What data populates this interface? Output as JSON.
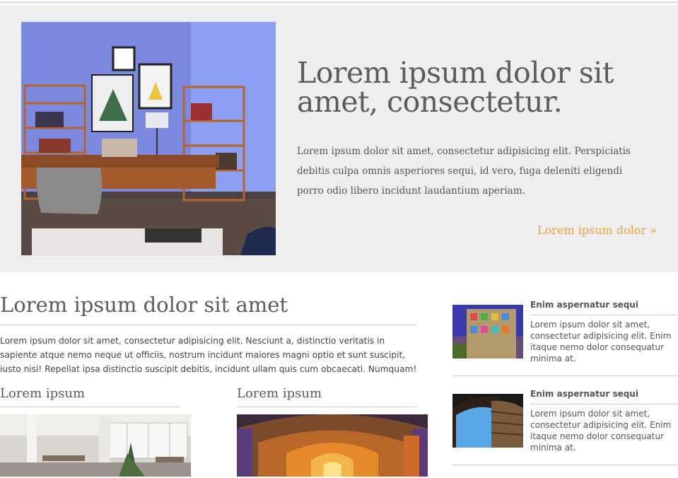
{
  "hero": {
    "title": "Lorem ipsum dolor sit amet, consectetur.",
    "text": "Lorem ipsum dolor sit amet, consectetur adipisicing elit. Perspiciatis debitis culpa omnis asperiores sequi, id vero, fuga deleniti eligendi porro odio libero incidunt laudantium aperiam.",
    "link": "Lorem ipsum dolor »",
    "link_color": "#e8a33d"
  },
  "main": {
    "title": "Lorem ipsum dolor sit amet",
    "text": "Lorem ipsum dolor sit amet, consectetur adipisicing elit. Nesciunt a, distinctio veritatis in sapiente atque nemo neque ut officiis, nostrum incidunt maiores magni optio et sunt suscipit, iusto nisi! Repellat ipsa distinctio suscipit debitis, incidunt ullam quis cum obcaecati. Numquam!",
    "columns": [
      {
        "title": "Lorem ipsum"
      },
      {
        "title": "Lorem ipsum"
      }
    ]
  },
  "sidebar": {
    "items": [
      {
        "title": "Enim aspernatur sequi",
        "text": "Lorem ipsum dolor sit amet, consectetur adipisicing elit. Enim itaque nemo dolor consequatur minima at."
      },
      {
        "title": "Enim aspernatur sequi",
        "text": "Lorem ipsum dolor sit amet, consectetur adipisicing elit. Enim itaque nemo dolor consequatur minima at."
      }
    ]
  }
}
